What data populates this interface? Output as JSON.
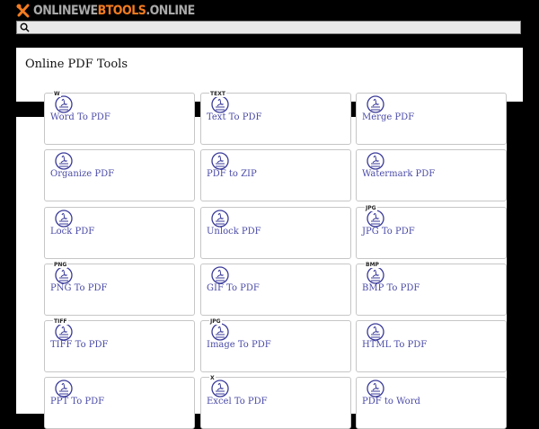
{
  "header": {
    "logo_part1": "Onlinewe",
    "logo_part2": "btools",
    "logo_part3": ".online"
  },
  "search": {
    "value": "",
    "placeholder": ""
  },
  "section": {
    "title": "Online PDF Tools"
  },
  "tools": [
    {
      "label": "Word To PDF",
      "badge": "W"
    },
    {
      "label": "Text To PDF",
      "badge": "TEXT"
    },
    {
      "label": "Merge PDF",
      "badge": ""
    },
    {
      "label": "Organize PDF",
      "badge": ""
    },
    {
      "label": "PDF to ZIP",
      "badge": ""
    },
    {
      "label": "Watermark PDF",
      "badge": ""
    },
    {
      "label": "Lock PDF",
      "badge": ""
    },
    {
      "label": "Unlock PDF",
      "badge": ""
    },
    {
      "label": "JPG To PDF",
      "badge": "JPG"
    },
    {
      "label": "PNG To PDF",
      "badge": "PNG"
    },
    {
      "label": "GIF To PDF",
      "badge": ""
    },
    {
      "label": "BMP To PDF",
      "badge": "BMP"
    },
    {
      "label": "TIFF To PDF",
      "badge": "TIFF"
    },
    {
      "label": "Image To PDF",
      "badge": "JPG"
    },
    {
      "label": "HTML To PDF",
      "badge": ""
    },
    {
      "label": "PPT To PDF",
      "badge": ""
    },
    {
      "label": "Excel To PDF",
      "badge": "X"
    },
    {
      "label": "PDF to Word",
      "badge": ""
    }
  ],
  "colors": {
    "accent": "#f47c20",
    "link": "#4a4aa8",
    "icon": "#3a3a9a",
    "background": "#000000"
  }
}
